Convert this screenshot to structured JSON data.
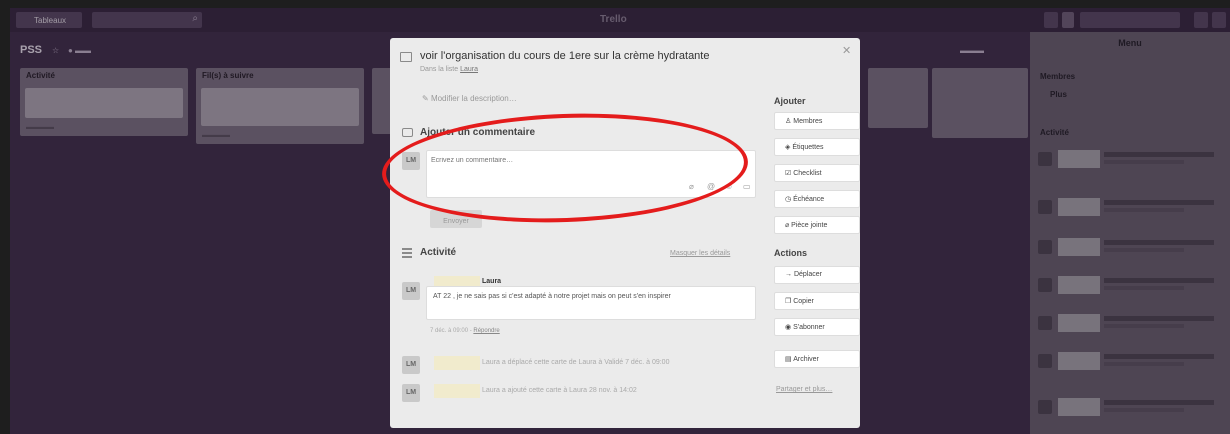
{
  "topbar": {
    "boards_label": "Tableaux",
    "logo": "Trello"
  },
  "board": {
    "name": "PSS"
  },
  "lists": [
    {
      "title": "Activité"
    },
    {
      "title": "Fil(s) à suivre"
    }
  ],
  "menu": {
    "title": "Menu",
    "members_label": "Membres",
    "plus_label": "Plus",
    "activity_label": "Activité"
  },
  "card": {
    "title": "voir l'organisation du cours de 1ere sur la crème hydratante",
    "in_list_prefix": "Dans la liste",
    "in_list_name": "Laura",
    "edit_description": "Modifier la description…",
    "add_comment_title": "Ajouter un commentaire",
    "comment_placeholder": "Écrivez un commentaire…",
    "send_label": "Envoyer",
    "avatar_initials": "LM",
    "activity_title": "Activité",
    "hide_details": "Masquer les détails",
    "comment": {
      "author": "Laura",
      "text": "AT 22 , je ne sais pas si c'est adapté à notre projet mais on peut s'en inspirer",
      "time": "7 déc. à 09:00 -",
      "reply": "Répondre"
    },
    "activities": [
      {
        "text": "Laura a déplacé cette carte de Laura à Validé",
        "time": "7 déc. à 09:00"
      },
      {
        "text": "Laura a ajouté cette carte à Laura",
        "time": "28 nov. à 14:02"
      }
    ]
  },
  "sidebar": {
    "add_title": "Ajouter",
    "add_buttons": [
      "Membres",
      "Étiquettes",
      "Checklist",
      "Échéance",
      "Pièce jointe"
    ],
    "actions_title": "Actions",
    "action_buttons": [
      "Déplacer",
      "Copier",
      "S'abonner",
      "Archiver"
    ],
    "share_link": "Partager et plus…"
  }
}
